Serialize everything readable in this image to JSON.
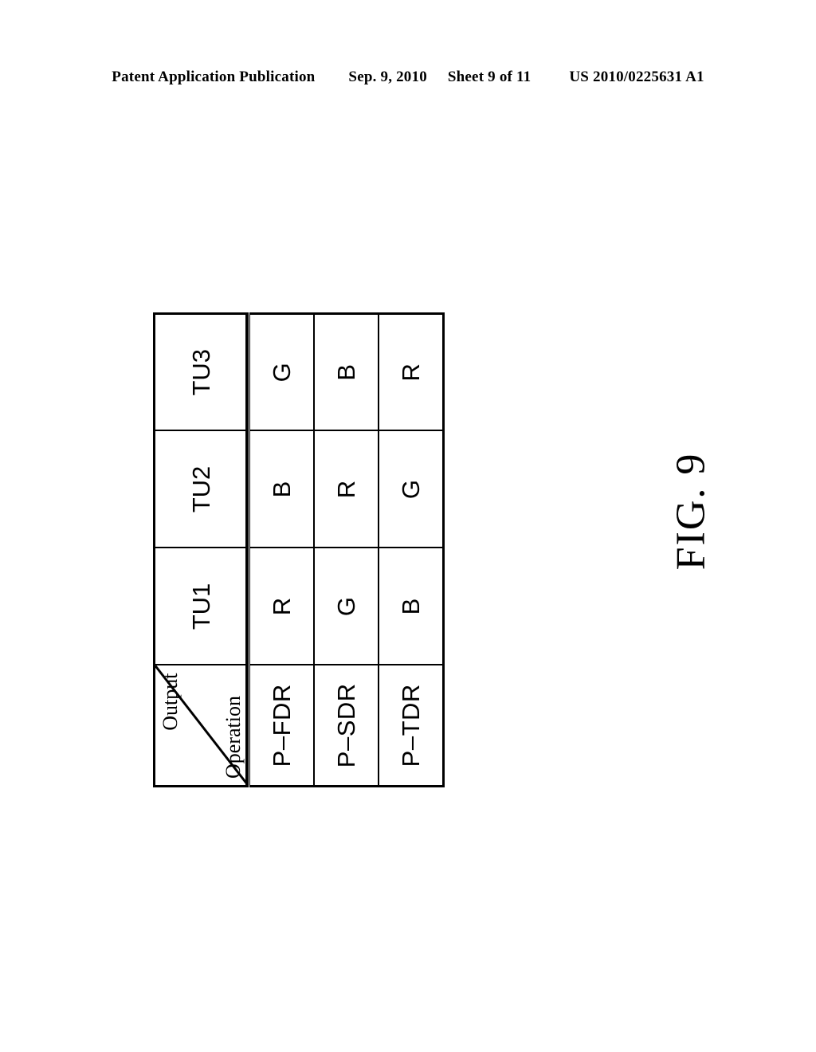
{
  "header": {
    "publication": "Patent Application Publication",
    "date": "Sep. 9, 2010",
    "sheet": "Sheet 9 of 11",
    "doc_number": "US 2010/0225631 A1"
  },
  "figure": {
    "caption": "FIG. 9",
    "table": {
      "corner": {
        "top_label": "Output",
        "bottom_label": "Operation"
      },
      "column_headers": [
        "TU1",
        "TU2",
        "TU3"
      ],
      "rows": [
        {
          "label": "P–FDR",
          "values": [
            "R",
            "B",
            "G"
          ]
        },
        {
          "label": "P–SDR",
          "values": [
            "G",
            "R",
            "B"
          ]
        },
        {
          "label": "P–TDR",
          "values": [
            "B",
            "G",
            "R"
          ]
        }
      ]
    }
  }
}
